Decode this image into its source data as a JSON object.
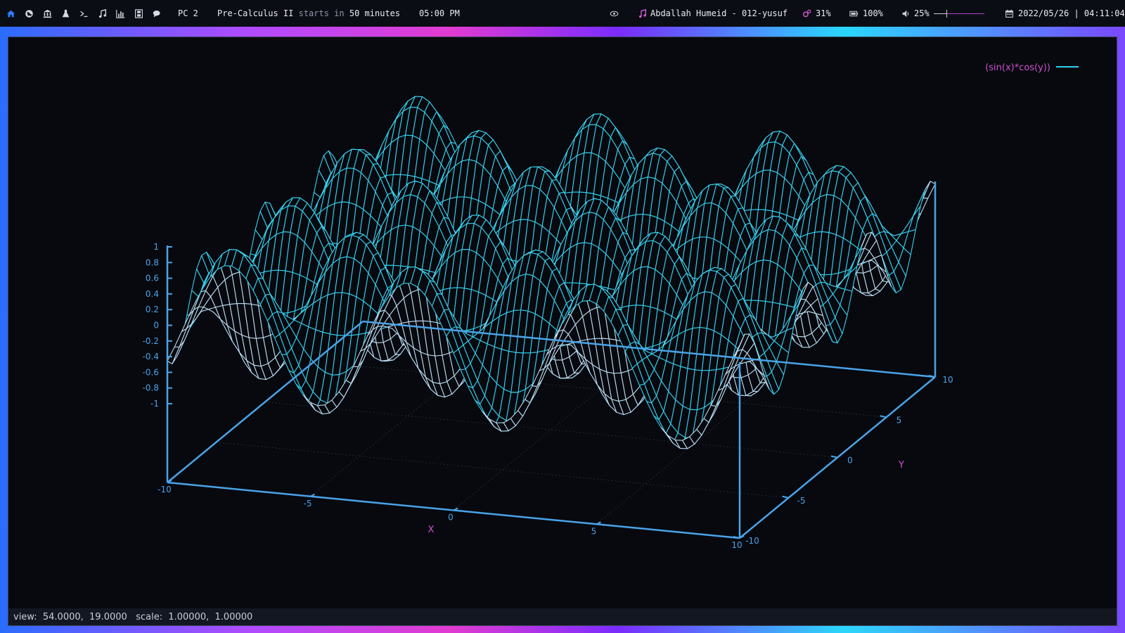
{
  "topbar": {
    "workspace": "PC 2",
    "event": {
      "name": "Pre-Calculus II",
      "starts_in_text": "starts in",
      "minutes": "50 minutes"
    },
    "event_time": "05:00 PM",
    "music": "Abdallah Humeid - 012-yusuf",
    "cpu": "31%",
    "battery": "100%",
    "volume": "25%",
    "volume_level": 0.25,
    "datetime": "2022/05/26 | 04:11:04",
    "launcher_icons": [
      "home-icon",
      "globe-icon",
      "bank-icon",
      "flask-icon",
      "terminal-icon",
      "music-note-icon",
      "bar-chart-icon",
      "film-icon",
      "chat-icon"
    ]
  },
  "plot": {
    "legend": "(sin(x)*cos(y))",
    "xlabel": "X",
    "ylabel": "Y",
    "function": "sin(x)*cos(y)",
    "x_range": [
      -10,
      10
    ],
    "y_range": [
      -10,
      10
    ],
    "z_range": [
      -1,
      1
    ],
    "x_ticks": [
      "-10",
      "-5",
      "0",
      "5",
      "10"
    ],
    "y_ticks": [
      "-10",
      "-5",
      "0",
      "5",
      "10"
    ],
    "z_ticks": [
      "1",
      "0.8",
      "0.6",
      "0.4",
      "0.2",
      "0",
      "-0.2",
      "-0.4",
      "-0.6",
      "-0.8",
      "-1"
    ],
    "colors": {
      "surface_top": "#33d0ee",
      "surface_bottom": "#b9d8ec",
      "axes": "#4aa3e8",
      "labels": "#d24fd2",
      "background": "#07090f"
    }
  },
  "chart_data": {
    "type": "surface",
    "function": "sin(x)*cos(y)",
    "x_range": [
      -10,
      10
    ],
    "y_range": [
      -10,
      10
    ],
    "z_range": [
      -1,
      1
    ],
    "legend": "(sin(x)*cos(y))",
    "xlabel": "X",
    "ylabel": "Y",
    "grid": true
  },
  "status": {
    "view_label": "view:",
    "view_value": "54.0000,  19.0000",
    "scale_label": "scale:",
    "scale_value": "1.00000,  1.00000"
  }
}
